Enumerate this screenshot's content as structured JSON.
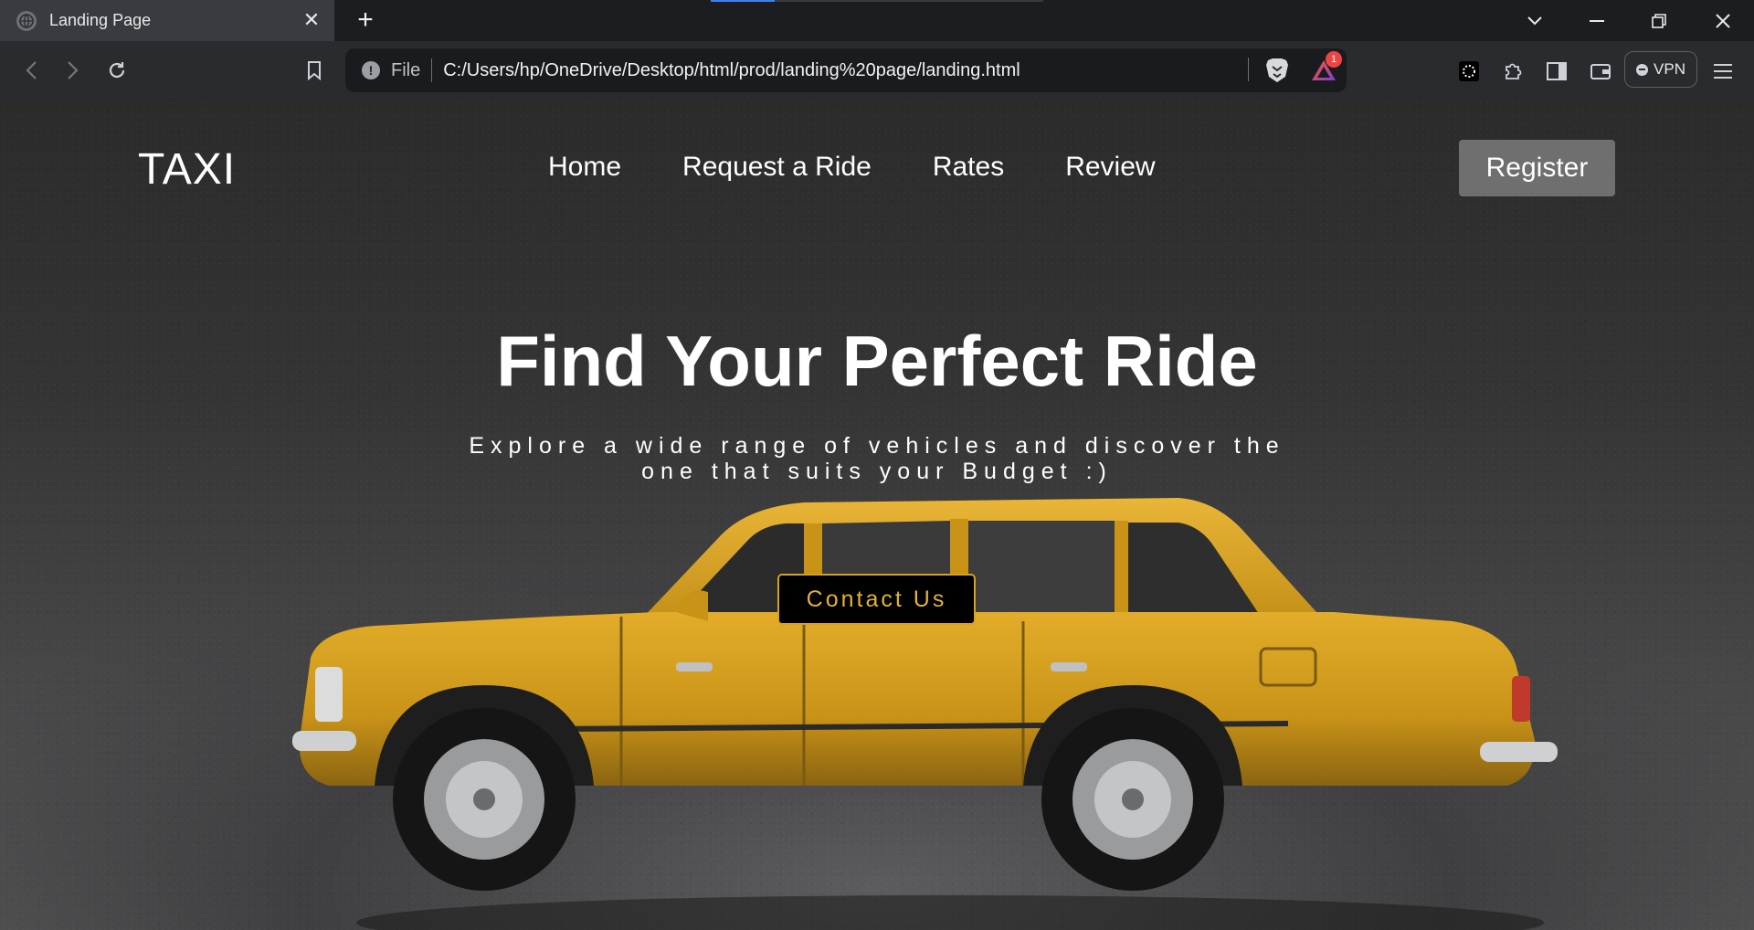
{
  "browser": {
    "tab_title": "Landing Page",
    "file_label": "File",
    "url": "C:/Users/hp/OneDrive/Desktop/html/prod/landing%20page/landing.html",
    "rewards_badge": "1",
    "vpn_label": "VPN"
  },
  "site": {
    "logo": "TAXI",
    "nav": [
      "Home",
      "Request a Ride",
      "Rates",
      "Review"
    ],
    "register": "Register",
    "hero_title": "Find Your Perfect Ride",
    "hero_subtitle_line1": "Explore a wide range of vehicles and discover the",
    "hero_subtitle_line2": "one that suits your Budget :)",
    "contact": "Contact Us"
  },
  "colors": {
    "accent_yellow": "#e2b23a",
    "car_yellow": "#d9a21f",
    "register_bg": "#6f6f70"
  }
}
